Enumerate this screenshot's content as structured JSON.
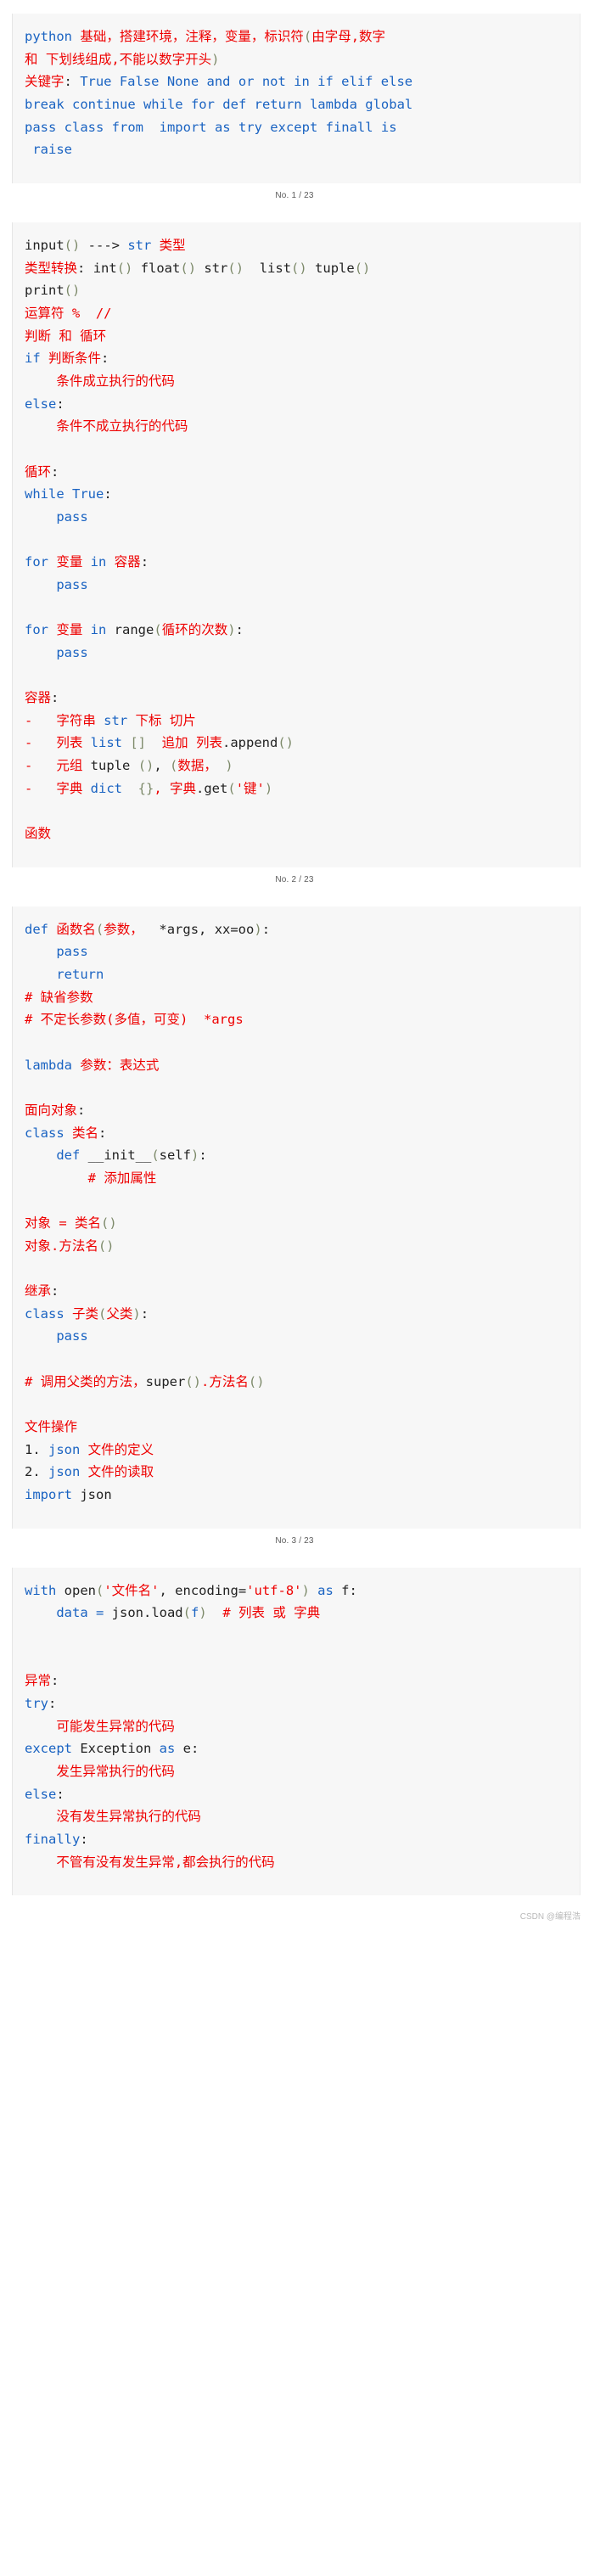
{
  "document": {
    "type": "code-notes-article",
    "total_pages_label": "23",
    "watermark": "CSDN @编程浩",
    "colors": {
      "background": "#ffffff",
      "code_background": "#f7f7f7",
      "chinese_text": "#ee0000",
      "keyword": "#1a63c2",
      "plain": "#222222",
      "paren": "#7d8a6a",
      "footer": "#5a5a5a",
      "watermark": "#b9b9b9"
    }
  },
  "blocks": [
    {
      "id": "block-1",
      "footer": "No. 1 / 23",
      "lines": [
        [
          {
            "t": "python ",
            "c": "kw"
          },
          {
            "t": "基础，搭建环境，注释，变量，标识符",
            "c": "cn"
          },
          {
            "t": "(",
            "c": "pr"
          },
          {
            "t": "由字母,数字",
            "c": "cn"
          }
        ],
        [
          {
            "t": "和 下划线组成,不能以数字开头",
            "c": "cn"
          },
          {
            "t": ")",
            "c": "pr"
          }
        ],
        [
          {
            "t": "关键字",
            "c": "cn"
          },
          {
            "t": ": ",
            "c": "pl"
          },
          {
            "t": "True False None and or not in if elif else",
            "c": "kw"
          }
        ],
        [
          {
            "t": "break continue while for def return lambda global",
            "c": "kw"
          }
        ],
        [
          {
            "t": "pass class from  import as try except finall is",
            "c": "kw"
          }
        ],
        [
          {
            "t": " raise",
            "c": "kw"
          }
        ]
      ]
    },
    {
      "id": "block-2",
      "footer": "No. 2 / 23",
      "lines": [
        [
          {
            "t": "input",
            "c": "pl"
          },
          {
            "t": "()",
            "c": "pr"
          },
          {
            "t": " ---> ",
            "c": "pl"
          },
          {
            "t": "str",
            "c": "kw"
          },
          {
            "t": " 类型",
            "c": "cn"
          }
        ],
        [
          {
            "t": "类型转换",
            "c": "cn"
          },
          {
            "t": ": ",
            "c": "pl"
          },
          {
            "t": "int",
            "c": "pl"
          },
          {
            "t": "()",
            "c": "pr"
          },
          {
            "t": " float",
            "c": "pl"
          },
          {
            "t": "()",
            "c": "pr"
          },
          {
            "t": " str",
            "c": "pl"
          },
          {
            "t": "()",
            "c": "pr"
          },
          {
            "t": "  list",
            "c": "pl"
          },
          {
            "t": "()",
            "c": "pr"
          },
          {
            "t": " tuple",
            "c": "pl"
          },
          {
            "t": "()",
            "c": "pr"
          }
        ],
        [
          {
            "t": "print",
            "c": "pl"
          },
          {
            "t": "()",
            "c": "pr"
          }
        ],
        [
          {
            "t": "运算符 % ",
            "c": "cn"
          },
          {
            "t": " //",
            "c": "cn"
          }
        ],
        [
          {
            "t": "判断 和 循环",
            "c": "cn"
          }
        ],
        [
          {
            "t": "if ",
            "c": "kw"
          },
          {
            "t": "判断条件",
            "c": "cn"
          },
          {
            "t": ":",
            "c": "pl"
          }
        ],
        [
          {
            "t": "    条件成立执行的代码",
            "c": "cn"
          }
        ],
        [
          {
            "t": "else",
            "c": "kw"
          },
          {
            "t": ":",
            "c": "pl"
          }
        ],
        [
          {
            "t": "    条件不成立执行的代码",
            "c": "cn"
          }
        ],
        [],
        [
          {
            "t": "循环",
            "c": "cn"
          },
          {
            "t": ":",
            "c": "pl"
          }
        ],
        [
          {
            "t": "while ",
            "c": "kw"
          },
          {
            "t": "True",
            "c": "kw"
          },
          {
            "t": ":",
            "c": "pl"
          }
        ],
        [
          {
            "t": "    pass",
            "c": "kw"
          }
        ],
        [],
        [
          {
            "t": "for ",
            "c": "kw"
          },
          {
            "t": "变量 ",
            "c": "cn"
          },
          {
            "t": "in ",
            "c": "kw"
          },
          {
            "t": "容器",
            "c": "cn"
          },
          {
            "t": ":",
            "c": "pl"
          }
        ],
        [
          {
            "t": "    pass",
            "c": "kw"
          }
        ],
        [],
        [
          {
            "t": "for ",
            "c": "kw"
          },
          {
            "t": "变量 ",
            "c": "cn"
          },
          {
            "t": "in ",
            "c": "kw"
          },
          {
            "t": "range",
            "c": "pl"
          },
          {
            "t": "(",
            "c": "pr"
          },
          {
            "t": "循环的次数",
            "c": "cn"
          },
          {
            "t": ")",
            "c": "pr"
          },
          {
            "t": ":",
            "c": "pl"
          }
        ],
        [
          {
            "t": "    pass",
            "c": "kw"
          }
        ],
        [],
        [
          {
            "t": "容器",
            "c": "cn"
          },
          {
            "t": ":",
            "c": "pl"
          }
        ],
        [
          {
            "t": "-",
            "c": "cn"
          },
          {
            "t": "   字符串 ",
            "c": "cn"
          },
          {
            "t": "str",
            "c": "kw"
          },
          {
            "t": " 下标 切片",
            "c": "cn"
          }
        ],
        [
          {
            "t": "-",
            "c": "cn"
          },
          {
            "t": "   列表 ",
            "c": "cn"
          },
          {
            "t": "list",
            "c": "kw"
          },
          {
            "t": " ",
            "c": "pl"
          },
          {
            "t": "[]",
            "c": "pr"
          },
          {
            "t": "  追加 列表",
            "c": "cn"
          },
          {
            "t": ".append",
            "c": "pl"
          },
          {
            "t": "()",
            "c": "pr"
          }
        ],
        [
          {
            "t": "-",
            "c": "cn"
          },
          {
            "t": "   元组 ",
            "c": "cn"
          },
          {
            "t": "tuple",
            "c": "pl"
          },
          {
            "t": " ",
            "c": "pl"
          },
          {
            "t": "()",
            "c": "pr"
          },
          {
            "t": ", ",
            "c": "pl"
          },
          {
            "t": "(",
            "c": "pr"
          },
          {
            "t": "数据，",
            "c": "cn"
          },
          {
            "t": " )",
            "c": "pr"
          }
        ],
        [
          {
            "t": "-",
            "c": "cn"
          },
          {
            "t": "   字典 ",
            "c": "cn"
          },
          {
            "t": "dict",
            "c": "kw"
          },
          {
            "t": "  ",
            "c": "pl"
          },
          {
            "t": "{}",
            "c": "pr"
          },
          {
            "t": ", 字典",
            "c": "cn"
          },
          {
            "t": ".get",
            "c": "pl"
          },
          {
            "t": "(",
            "c": "pr"
          },
          {
            "t": "'键'",
            "c": "cn"
          },
          {
            "t": ")",
            "c": "pr"
          }
        ],
        [],
        [
          {
            "t": "函数",
            "c": "cn"
          }
        ]
      ]
    },
    {
      "id": "block-3",
      "footer": "No. 3 / 23",
      "lines": [
        [
          {
            "t": "def ",
            "c": "kw"
          },
          {
            "t": "函数名",
            "c": "cn"
          },
          {
            "t": "(",
            "c": "pr"
          },
          {
            "t": "参数，",
            "c": "cn"
          },
          {
            "t": "  *args, xx=oo",
            "c": "pl"
          },
          {
            "t": ")",
            "c": "pr"
          },
          {
            "t": ":",
            "c": "pl"
          }
        ],
        [
          {
            "t": "    pass",
            "c": "kw"
          }
        ],
        [
          {
            "t": "    return",
            "c": "kw"
          }
        ],
        [
          {
            "t": "# 缺省参数",
            "c": "cn"
          }
        ],
        [
          {
            "t": "# 不定长参数(多值，可变) ",
            "c": "cn"
          },
          {
            "t": " *args",
            "c": "cn"
          }
        ],
        [],
        [
          {
            "t": "lambda ",
            "c": "kw"
          },
          {
            "t": "参数：表达式",
            "c": "cn"
          }
        ],
        [],
        [
          {
            "t": "面向对象",
            "c": "cn"
          },
          {
            "t": ":",
            "c": "pl"
          }
        ],
        [
          {
            "t": "class ",
            "c": "kw"
          },
          {
            "t": "类名",
            "c": "cn"
          },
          {
            "t": ":",
            "c": "pl"
          }
        ],
        [
          {
            "t": "    def ",
            "c": "kw"
          },
          {
            "t": "__init__",
            "c": "pl"
          },
          {
            "t": "(",
            "c": "pr"
          },
          {
            "t": "self",
            "c": "pl"
          },
          {
            "t": ")",
            "c": "pr"
          },
          {
            "t": ":",
            "c": "pl"
          }
        ],
        [
          {
            "t": "        # 添加属性",
            "c": "cn"
          }
        ],
        [],
        [
          {
            "t": "对象 = 类名",
            "c": "cn"
          },
          {
            "t": "()",
            "c": "pr"
          }
        ],
        [
          {
            "t": "对象.方法名",
            "c": "cn"
          },
          {
            "t": "()",
            "c": "pr"
          }
        ],
        [],
        [
          {
            "t": "继承",
            "c": "cn"
          },
          {
            "t": ":",
            "c": "pl"
          }
        ],
        [
          {
            "t": "class ",
            "c": "kw"
          },
          {
            "t": "子类",
            "c": "cn"
          },
          {
            "t": "(",
            "c": "pr"
          },
          {
            "t": "父类",
            "c": "cn"
          },
          {
            "t": ")",
            "c": "pr"
          },
          {
            "t": ":",
            "c": "pl"
          }
        ],
        [
          {
            "t": "    pass",
            "c": "kw"
          }
        ],
        [],
        [
          {
            "t": "# 调用父类的方法，",
            "c": "cn"
          },
          {
            "t": "super",
            "c": "pl"
          },
          {
            "t": "()",
            "c": "pr"
          },
          {
            "t": ".方法名",
            "c": "cn"
          },
          {
            "t": "()",
            "c": "pr"
          }
        ],
        [],
        [
          {
            "t": "文件操作",
            "c": "cn"
          }
        ],
        [
          {
            "t": "1. ",
            "c": "pl"
          },
          {
            "t": "json ",
            "c": "kw"
          },
          {
            "t": "文件的定义",
            "c": "cn"
          }
        ],
        [
          {
            "t": "2. ",
            "c": "pl"
          },
          {
            "t": "json ",
            "c": "kw"
          },
          {
            "t": "文件的读取",
            "c": "cn"
          }
        ],
        [
          {
            "t": "import ",
            "c": "kw"
          },
          {
            "t": "json",
            "c": "pl"
          }
        ]
      ]
    },
    {
      "id": "block-4",
      "footer": "",
      "lines": [
        [
          {
            "t": "with ",
            "c": "kw"
          },
          {
            "t": "open",
            "c": "pl"
          },
          {
            "t": "(",
            "c": "pr"
          },
          {
            "t": "'文件名'",
            "c": "cn"
          },
          {
            "t": ", encoding=",
            "c": "pl"
          },
          {
            "t": "'utf-8'",
            "c": "cn"
          },
          {
            "t": ")",
            "c": "pr"
          },
          {
            "t": " as ",
            "c": "kw"
          },
          {
            "t": "f",
            "c": "pl"
          },
          {
            "t": ":",
            "c": "pl"
          }
        ],
        [
          {
            "t": "    data = ",
            "c": "kw"
          },
          {
            "t": "json.load",
            "c": "pl"
          },
          {
            "t": "(",
            "c": "pr"
          },
          {
            "t": "f",
            "c": "kw"
          },
          {
            "t": ")",
            "c": "pr"
          },
          {
            "t": "  # 列表 或 字典",
            "c": "cn"
          }
        ],
        [],
        [],
        [
          {
            "t": "异常",
            "c": "cn"
          },
          {
            "t": ":",
            "c": "pl"
          }
        ],
        [
          {
            "t": "try",
            "c": "kw"
          },
          {
            "t": ":",
            "c": "pl"
          }
        ],
        [
          {
            "t": "    可能发生异常的代码",
            "c": "cn"
          }
        ],
        [
          {
            "t": "except ",
            "c": "kw"
          },
          {
            "t": "Exception",
            "c": "pl"
          },
          {
            "t": " as ",
            "c": "kw"
          },
          {
            "t": "e",
            "c": "pl"
          },
          {
            "t": ":",
            "c": "pl"
          }
        ],
        [
          {
            "t": "    发生异常执行的代码",
            "c": "cn"
          }
        ],
        [
          {
            "t": "else",
            "c": "kw"
          },
          {
            "t": ":",
            "c": "pl"
          }
        ],
        [
          {
            "t": "    没有发生异常执行的代码",
            "c": "cn"
          }
        ],
        [
          {
            "t": "finally",
            "c": "kw"
          },
          {
            "t": ":",
            "c": "pl"
          }
        ],
        [
          {
            "t": "    不管有没有发生异常,都会执行的代码",
            "c": "cn"
          }
        ]
      ]
    }
  ]
}
